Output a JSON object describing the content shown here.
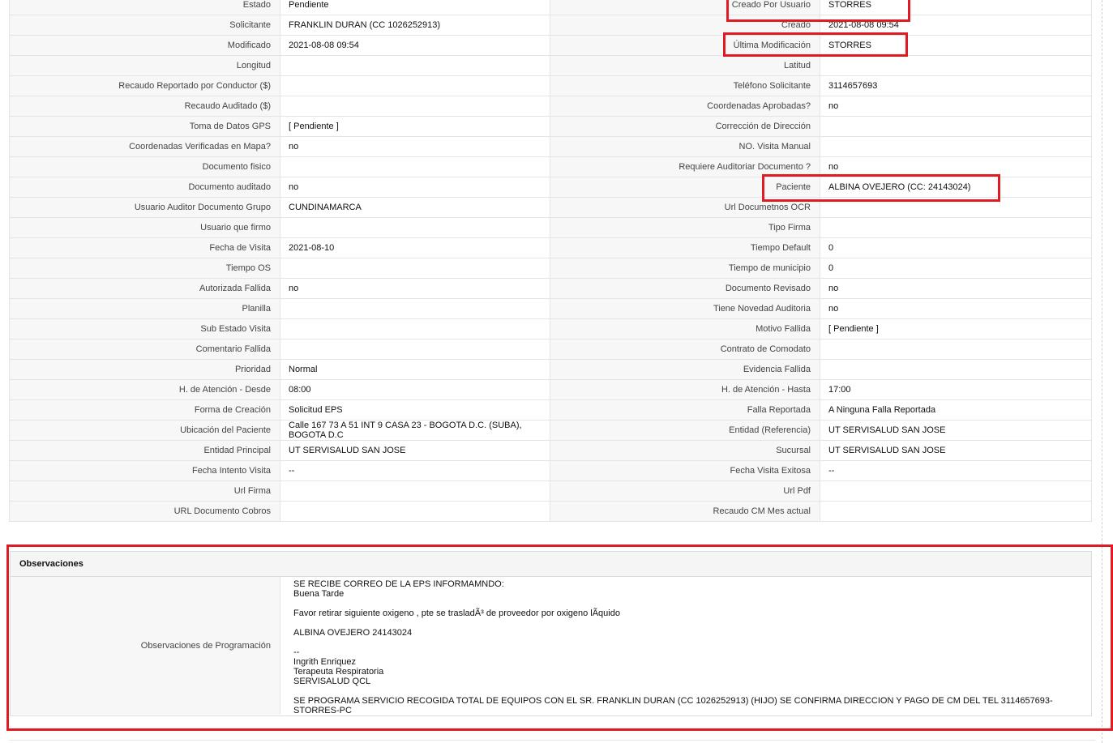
{
  "rows": [
    {
      "l1": "Estado",
      "v1": "Pendiente",
      "l2": "Creado Por Usuario",
      "v2": "STORRES"
    },
    {
      "l1": "Solicitante",
      "v1": "FRANKLIN DURAN (CC 1026252913)",
      "l2": "Creado",
      "v2": "2021-08-08 09:54"
    },
    {
      "l1": "Modificado",
      "v1": "2021-08-08 09:54",
      "l2": "Última Modificación",
      "v2": " STORRES"
    },
    {
      "l1": "Longitud",
      "v1": "",
      "l2": "Latitud",
      "v2": ""
    },
    {
      "l1": "Recaudo Reportado por Conductor ($)",
      "v1": "",
      "l2": "Teléfono Solicitante",
      "v2": "3114657693"
    },
    {
      "l1": "Recaudo Auditado ($)",
      "v1": "",
      "l2": "Coordenadas Aprobadas?",
      "v2": " no"
    },
    {
      "l1": "Toma de Datos GPS",
      "v1": "[ Pendiente ]",
      "l2": "Corrección de Dirección",
      "v2": ""
    },
    {
      "l1": "Coordenadas Verificadas en Mapa?",
      "v1": " no",
      "l2": "NO. Visita Manual",
      "v2": ""
    },
    {
      "l1": "Documento fisico",
      "v1": "",
      "l2": "Requiere Auditoriar Documento ?",
      "v2": " no"
    },
    {
      "l1": "Documento auditado",
      "v1": " no",
      "l2": "Paciente",
      "v2": "ALBINA OVEJERO (CC: 24143024)"
    },
    {
      "l1": "Usuario Auditor Documento Grupo",
      "v1": "CUNDINAMARCA",
      "l2": "Url Documetnos OCR",
      "v2": ""
    },
    {
      "l1": "Usuario que firmo",
      "v1": "",
      "l2": "Tipo Firma",
      "v2": ""
    },
    {
      "l1": "Fecha de Visita",
      "v1": " 2021-08-10",
      "l2": "Tiempo Default",
      "v2": "0"
    },
    {
      "l1": "Tiempo OS",
      "v1": "",
      "l2": "Tiempo de municipio",
      "v2": "0"
    },
    {
      "l1": "Autorizada Fallida",
      "v1": " no",
      "l2": "Documento Revisado",
      "v2": " no"
    },
    {
      "l1": "Planilla",
      "v1": "",
      "l2": "Tiene Novedad Auditoria",
      "v2": " no"
    },
    {
      "l1": "Sub Estado Visita",
      "v1": "",
      "l2": "Motivo Fallida",
      "v2": "[ Pendiente ]"
    },
    {
      "l1": "Comentario Fallida",
      "v1": "",
      "l2": "Contrato de Comodato",
      "v2": ""
    },
    {
      "l1": "Prioridad",
      "v1": "Normal",
      "l2": "Evidencia Fallida",
      "v2": ""
    },
    {
      "l1": "H. de Atención - Desde",
      "v1": "08:00",
      "l2": "H. de Atención - Hasta",
      "v2": "17:00"
    },
    {
      "l1": "Forma de Creación",
      "v1": "Solicitud EPS",
      "l2": "Falla Reportada",
      "v2": "A Ninguna Falla Reportada"
    },
    {
      "l1": "Ubicación del Paciente",
      "v1": "Calle 167 73 A 51 INT 9 CASA 23 - BOGOTA D.C. (SUBA), BOGOTA D.C",
      "l2": "Entidad (Referencia)",
      "v2": "UT SERVISALUD SAN JOSE"
    },
    {
      "l1": "Entidad Principal",
      "v1": "UT SERVISALUD SAN JOSE",
      "l2": "Sucursal",
      "v2": "UT SERVISALUD SAN JOSE"
    },
    {
      "l1": "Fecha Intento Visita",
      "v1": " --",
      "l2": "Fecha Visita Exitosa",
      "v2": " --"
    },
    {
      "l1": "Url Firma",
      "v1": "",
      "l2": "Url Pdf",
      "v2": ""
    },
    {
      "l1": "URL Documento Cobros",
      "v1": "",
      "l2": "Recaudo CM Mes actual",
      "v2": ""
    }
  ],
  "observaciones": {
    "title": "Observaciones",
    "label": "Observaciones de Programación",
    "text": "SE RECIBE CORREO DE LA EPS INFORMAMNDO:\nBuena Tarde\n\nFavor retirar siguiente oxigeno , pte se trasladÃ³ de proveedor por oxigeno lÃ­quido\n\nALBINA OVEJERO 24143024\n\n--\nIngrith Enriquez\nTerapeuta Respiratoria\nSERVISALUD QCL\n\nSE PROGRAMA SERVICIO RECOGIDA TOTAL DE EQUIPOS CON EL SR. FRANKLIN DURAN (CC 1026252913) (HIJO) SE CONFIRMA DIRECCION Y PAGO DE CM DEL TEL 3114657693-\nSTORRES-PC"
  },
  "colors": {
    "highlight": "#e01b24",
    "label_bg": "#f7f7f7",
    "border": "#e4e4e4"
  }
}
